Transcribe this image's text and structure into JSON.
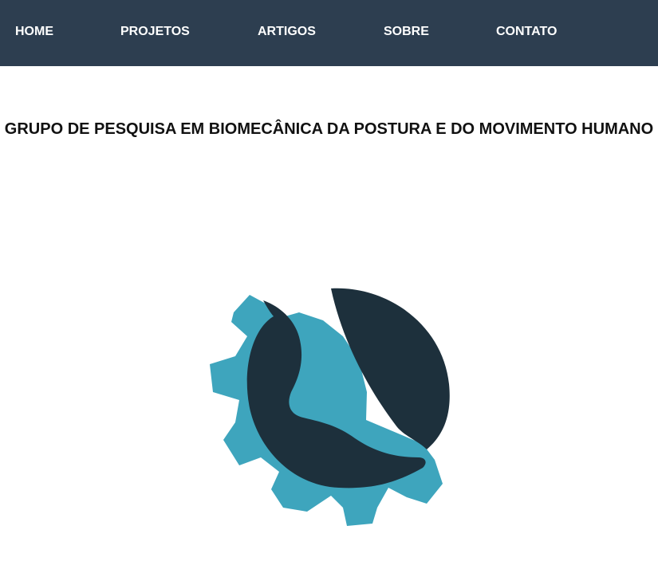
{
  "nav": {
    "background": "#2d3e50",
    "items": [
      {
        "label": "HOME"
      },
      {
        "label": "PROJETOS"
      },
      {
        "label": "ARTIGOS"
      },
      {
        "label": "SOBRE"
      },
      {
        "label": "CONTATO"
      }
    ]
  },
  "main": {
    "title": "GRUPO DE PESQUISA EM BIOMECÂNICA DA POSTURA E DO MOVIMENTO HUMANO"
  },
  "logo": {
    "icon": "gear-foot-logo",
    "gear_color": "#3ea5bd",
    "foot_color": "#1d303c"
  }
}
